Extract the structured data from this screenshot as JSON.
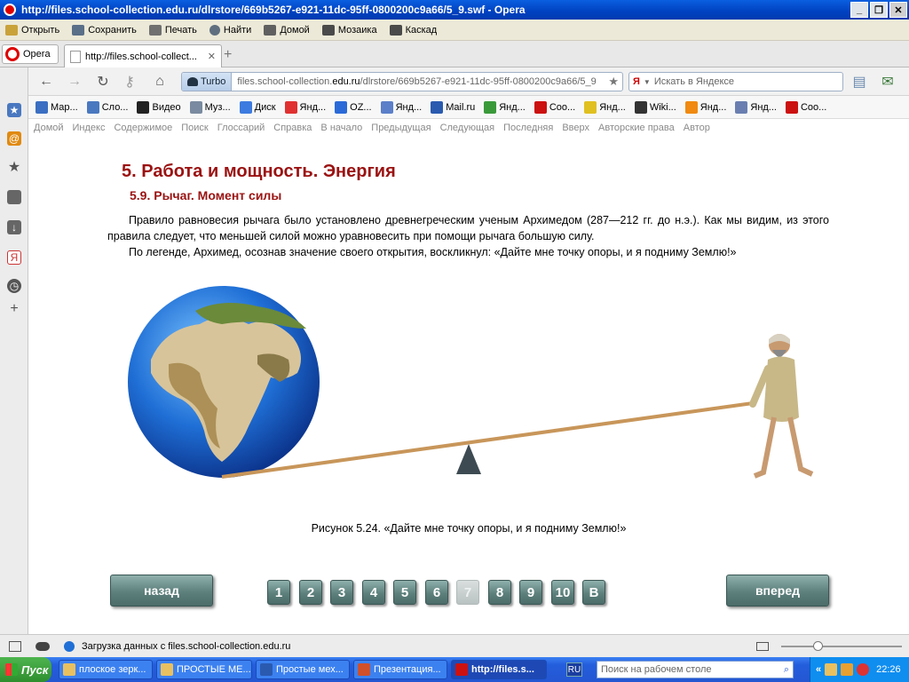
{
  "window": {
    "title": "http://files.school-collection.edu.ru/dlrstore/669b5267-e921-11dc-95ff-0800200c9a66/5_9.swf - Opera",
    "minimize": "_",
    "maximize": "❐",
    "close": "✕"
  },
  "menubar": {
    "items": [
      {
        "label": "Открыть",
        "icon": "folder-icon"
      },
      {
        "label": "Сохранить",
        "icon": "save-icon"
      },
      {
        "label": "Печать",
        "icon": "print-icon"
      },
      {
        "label": "Найти",
        "icon": "find-icon"
      },
      {
        "label": "Домой",
        "icon": "home-icon"
      },
      {
        "label": "Мозаика",
        "icon": "tile-icon"
      },
      {
        "label": "Каскад",
        "icon": "cascade-icon"
      }
    ]
  },
  "tabs": {
    "opera_menu": "Opera",
    "active_tab": "http://files.school-collect...",
    "new_tab": "+"
  },
  "address": {
    "turbo": "Turbo",
    "url_prefix": "files.school-collection.",
    "url_domain": "edu.ru",
    "url_path": "/dlrstore/669b5267-e921-11dc-95ff-0800200c9a66/5_9",
    "search_engine": "Я",
    "search_placeholder": "Искать в Яндексе"
  },
  "bookmarks": [
    {
      "label": "Мар...",
      "color": "#3b6fc2"
    },
    {
      "label": "Сло...",
      "color": "#4a78c0"
    },
    {
      "label": "Видео",
      "color": "#222222"
    },
    {
      "label": "Муз...",
      "color": "#7a8aa0"
    },
    {
      "label": "Диск",
      "color": "#3d7be0"
    },
    {
      "label": "Янд...",
      "color": "#e03030"
    },
    {
      "label": "OZ...",
      "color": "#2a6ad8"
    },
    {
      "label": "Янд...",
      "color": "#5b7fc9"
    },
    {
      "label": "Mail.ru",
      "color": "#2a5ab0"
    },
    {
      "label": "Янд...",
      "color": "#3a9a3a"
    },
    {
      "label": "Соо...",
      "color": "#cc1111"
    },
    {
      "label": "Янд...",
      "color": "#e0c020"
    },
    {
      "label": "Wiki...",
      "color": "#333333"
    },
    {
      "label": "Янд...",
      "color": "#f08a10"
    },
    {
      "label": "Янд...",
      "color": "#6a7fb0"
    },
    {
      "label": "Соо...",
      "color": "#cc1111"
    }
  ],
  "content_nav": [
    "Домой",
    "Индекс",
    "Содержимое",
    "Поиск",
    "Глоссарий",
    "Справка",
    "В начало",
    "Предыдущая",
    "Следующая",
    "Последняя",
    "Вверх",
    "Авторские права",
    "Автор"
  ],
  "lesson": {
    "title": "5. Работа и мощность. Энергия",
    "subtitle": "5.9. Рычаг. Момент силы",
    "para1": "Правило равновесия рычага было установлено древнегреческим ученым Архимедом (287—212 гг. до н.э.). Как мы видим, из этого правила следует, что меньшей силой можно уравновесить при помощи рычага большую силу.",
    "para2": "По легенде, Архимед, осознав значение своего открытия, воскликнул: «Дайте мне точку опоры, и я подниму Землю!»",
    "caption": "Рисунок 5.24. «Дайте мне точку опоры, и я подниму Землю!»"
  },
  "navigation": {
    "back": "назад",
    "forward": "вперед",
    "pages": [
      "1",
      "2",
      "3",
      "4",
      "5",
      "6",
      "7",
      "8",
      "9",
      "10",
      "В"
    ],
    "current_page": "7"
  },
  "statusbar": {
    "text": "Загрузка данных с files.school-collection.edu.ru"
  },
  "taskbar": {
    "start": "Пуск",
    "tasks": [
      {
        "label": "плоское зерк...",
        "color": "#e8c060"
      },
      {
        "label": "ПРОСТЫЕ МЕ...",
        "color": "#e8c060"
      },
      {
        "label": "Простые мех...",
        "color": "#2a5ab0"
      },
      {
        "label": "Презентация...",
        "color": "#d0502a"
      },
      {
        "label": "http://files.s...",
        "color": "#cc1111"
      }
    ],
    "lang": "RU",
    "search_placeholder": "Поиск на рабочем столе",
    "tray_more": "«",
    "clock": "22:26"
  }
}
